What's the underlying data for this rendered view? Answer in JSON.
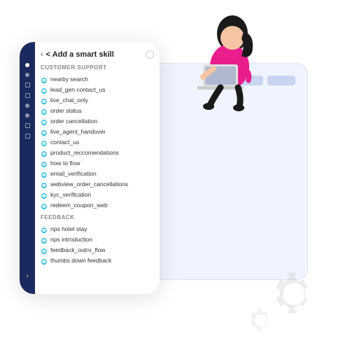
{
  "header": {
    "back_label": "< Add a smart skill",
    "circle_label": ""
  },
  "customer_support": {
    "section_label": "Customer Support",
    "items": [
      "nearby search",
      "lead_gen contact_us",
      "live_chat_only",
      "order status",
      "order cancellation",
      "live_agent_handover",
      "contact_us",
      "product_reccomendations",
      "how to flow",
      "email_verification",
      "webview_order_cancellations",
      "kyc_verification",
      "redeem_coupon_web"
    ]
  },
  "feedback": {
    "section_label": "Feedback",
    "items": [
      "nps hotel stay",
      "nps introduction",
      "feedback_outro_flow",
      "thumbs down feedback"
    ]
  },
  "colors": {
    "sidebar_bg": "#1a2a5e",
    "accent": "#00b4d8",
    "text_dark": "#222",
    "text_muted": "#888"
  }
}
